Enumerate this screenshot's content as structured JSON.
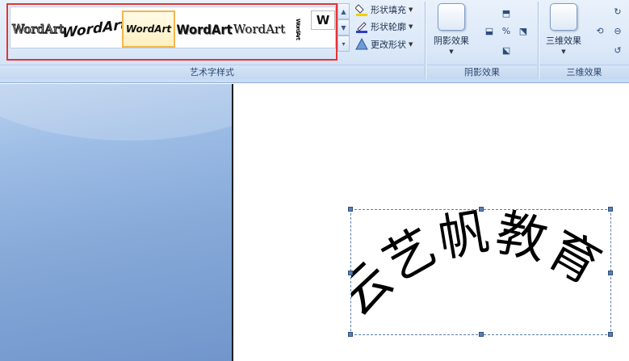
{
  "ribbon": {
    "wordart_styles": {
      "group_label": "艺术字样式",
      "gallery": [
        {
          "text": "WordArt"
        },
        {
          "text": "WordArt"
        },
        {
          "text": "WordArt"
        },
        {
          "text": "WordArt"
        },
        {
          "text": "WordArt"
        },
        {
          "text": "WordArt"
        },
        {
          "text": "W"
        }
      ],
      "commands": [
        {
          "label": "形状填充",
          "icon": "paint-bucket-icon"
        },
        {
          "label": "形状轮廓",
          "icon": "pen-outline-icon"
        },
        {
          "label": "更改形状",
          "icon": "change-shape-icon"
        }
      ]
    },
    "shadow_effects": {
      "group_label": "阴影效果",
      "button_label": "阴影效果"
    },
    "threed_effects": {
      "group_label": "三维效果",
      "button_label": "三维效果"
    }
  },
  "document": {
    "wordart_text": "云艺帆教育"
  },
  "colors": {
    "selection_border": "#e53333",
    "ribbon_bg": "#dbe8f8",
    "left_pane": "#86a9d8"
  }
}
